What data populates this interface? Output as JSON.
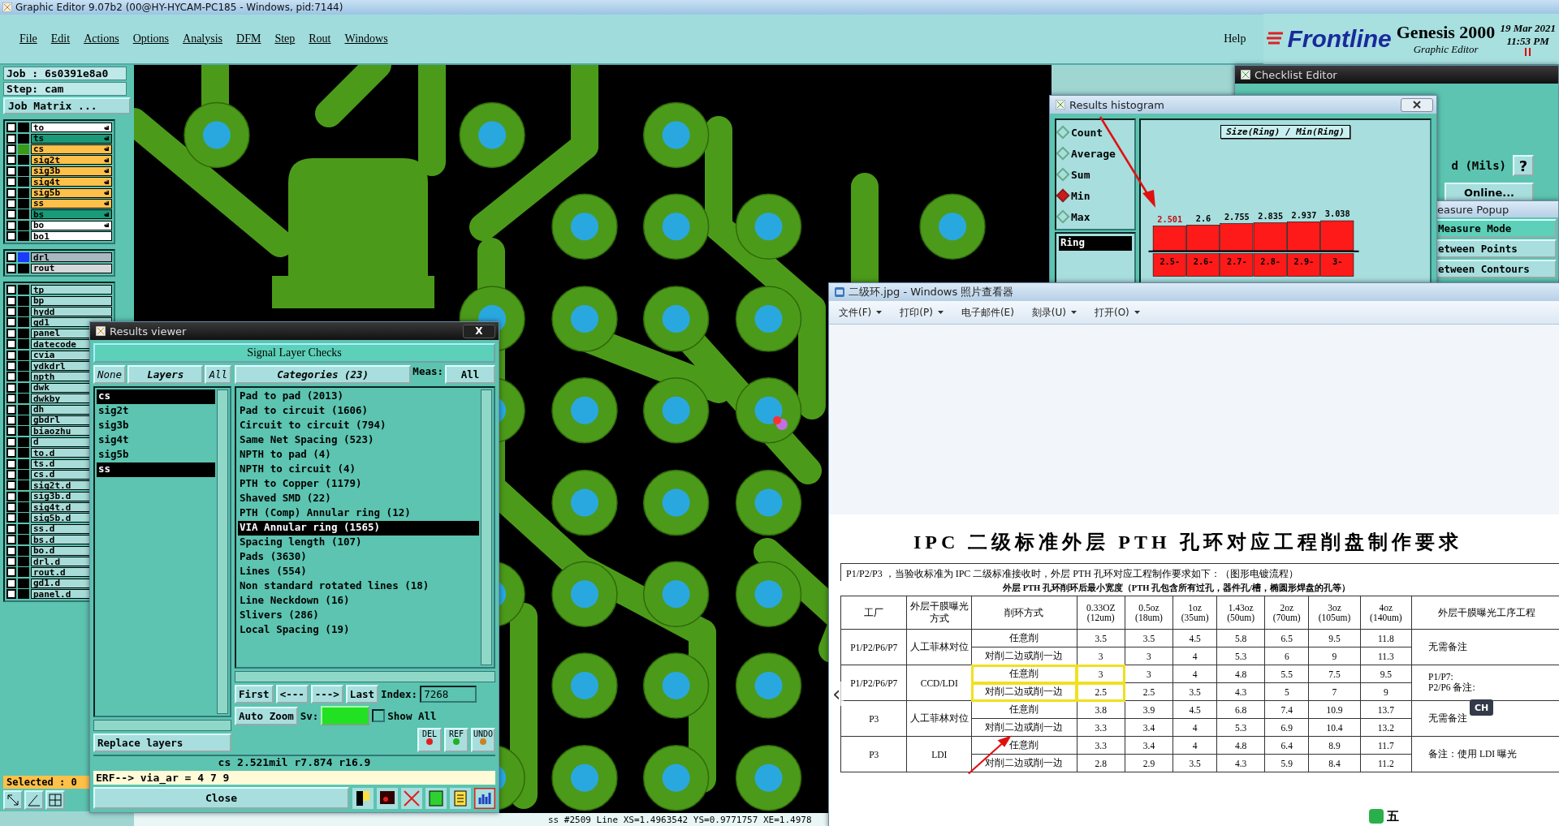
{
  "window": {
    "title": "Graphic Editor 9.07b2 (00@HY-HYCAM-PC185 - Windows, pid:7144)"
  },
  "menu": [
    "File",
    "Edit",
    "Actions",
    "Options",
    "Analysis",
    "DFM",
    "Step",
    "Rout",
    "Windows"
  ],
  "help": "Help",
  "brand": {
    "logo": "Frontline",
    "product": "Genesis 2000",
    "subtitle": "Graphic Editor",
    "date": "19 Mar 2021",
    "time": "11:53 PM"
  },
  "job": {
    "job": "Job : 6s0391e8a0",
    "step": "Step: cam",
    "matrix_button": "Job Matrix ..."
  },
  "layer_groups": [
    [
      {
        "name": "to",
        "checked": false,
        "color": "#ffffff",
        "hand_icon": true
      },
      {
        "name": "ts",
        "checked": false,
        "color": "#1a9a78",
        "hand_icon": true
      },
      {
        "name": "cs",
        "checked": false,
        "color": "#ffc04a",
        "hand_icon": true,
        "marker": {
          "color": "#3a9a1a"
        }
      },
      {
        "name": "sig2t",
        "checked": false,
        "color": "#ffc04a",
        "hand_icon": true
      },
      {
        "name": "sig3b",
        "checked": false,
        "color": "#ffc04a",
        "hand_icon": true
      },
      {
        "name": "sig4t",
        "checked": false,
        "color": "#ffc04a",
        "hand_icon": true
      },
      {
        "name": "sig5b",
        "checked": false,
        "color": "#ffc04a",
        "hand_icon": true
      },
      {
        "name": "ss",
        "checked": false,
        "color": "#ffc04a",
        "hand_icon": true
      },
      {
        "name": "bs",
        "checked": false,
        "color": "#1a9a78",
        "hand_icon": true
      },
      {
        "name": "bo",
        "checked": false,
        "color": "#ffffff",
        "hand_icon": true
      },
      {
        "name": "bo1",
        "checked": false,
        "color": "#ffffff",
        "hand_icon": false
      }
    ],
    [
      {
        "name": "drl",
        "checked": false,
        "color": "#a8b8c0",
        "hand_icon": false,
        "marker": {
          "color": "#1a3aff"
        }
      },
      {
        "name": "rout",
        "checked": false,
        "color": "#d4d8d8",
        "hand_icon": false
      }
    ],
    [
      {
        "name": "tp",
        "checked": false,
        "color": "#a8dcd8",
        "hand_icon": false
      },
      {
        "name": "bp",
        "checked": false,
        "color": "#a8dcd8",
        "hand_icon": false
      },
      {
        "name": "hydd",
        "checked": false,
        "color": "#a8dcd8",
        "hand_icon": false
      },
      {
        "name": "gd1",
        "checked": false,
        "color": "#a8dcd8",
        "hand_icon": false
      },
      {
        "name": "panel",
        "checked": false,
        "color": "#a8dcd8",
        "hand_icon": false
      },
      {
        "name": "datecode",
        "checked": false,
        "color": "#a8dcd8",
        "hand_icon": false
      },
      {
        "name": "cvia",
        "checked": false,
        "color": "#a8dcd8",
        "hand_icon": false
      },
      {
        "name": "ydkdrl",
        "checked": false,
        "color": "#a8dcd8",
        "hand_icon": false
      },
      {
        "name": "npth",
        "checked": false,
        "color": "#a8dcd8",
        "hand_icon": false
      },
      {
        "name": "dwk",
        "checked": false,
        "color": "#a8dcd8",
        "hand_icon": false
      },
      {
        "name": "dwkby",
        "checked": false,
        "color": "#a8dcd8",
        "hand_icon": false
      },
      {
        "name": "dh",
        "checked": false,
        "color": "#a8dcd8",
        "hand_icon": false
      },
      {
        "name": "gbdrl",
        "checked": false,
        "color": "#a8dcd8",
        "hand_icon": false
      },
      {
        "name": "biaozhu",
        "checked": false,
        "color": "#a8dcd8",
        "hand_icon": false
      },
      {
        "name": "d",
        "checked": false,
        "color": "#a8dcd8",
        "hand_icon": false
      },
      {
        "name": "to.d",
        "checked": false,
        "color": "#a8dcd8",
        "hand_icon": false
      },
      {
        "name": "ts.d",
        "checked": false,
        "color": "#a8dcd8",
        "hand_icon": false
      },
      {
        "name": "cs.d",
        "checked": false,
        "color": "#a8dcd8",
        "hand_icon": false
      },
      {
        "name": "sig2t.d",
        "checked": false,
        "color": "#a8dcd8",
        "hand_icon": false
      },
      {
        "name": "sig3b.d",
        "checked": false,
        "color": "#a8dcd8",
        "hand_icon": false
      },
      {
        "name": "sig4t.d",
        "checked": false,
        "color": "#a8dcd8",
        "hand_icon": false
      },
      {
        "name": "sig5b.d",
        "checked": false,
        "color": "#a8dcd8",
        "hand_icon": false
      },
      {
        "name": "ss.d",
        "checked": false,
        "color": "#a8dcd8",
        "hand_icon": false
      },
      {
        "name": "bs.d",
        "checked": false,
        "color": "#a8dcd8",
        "hand_icon": false
      },
      {
        "name": "bo.d",
        "checked": false,
        "color": "#a8dcd8",
        "hand_icon": false
      },
      {
        "name": "drl.d",
        "checked": false,
        "color": "#a8dcd8",
        "hand_icon": false
      },
      {
        "name": "rout.d",
        "checked": false,
        "color": "#a8dcd8",
        "hand_icon": false
      },
      {
        "name": "gd1.d",
        "checked": false,
        "color": "#a8dcd8",
        "hand_icon": false
      },
      {
        "name": "panel.d",
        "checked": false,
        "color": "#a8dcd8",
        "hand_icon": false
      }
    ]
  ],
  "selected_count": "Selected : 0",
  "status_line": "ss #2509 Line XS=1.4963542 YS=0.9771757 XE=1.4978",
  "results_viewer": {
    "title": "Results viewer",
    "close_glyph": "X",
    "heading": "Signal Layer Checks",
    "layer_buttons": [
      "None",
      "Layers",
      "All"
    ],
    "layers": [
      {
        "name": "cs",
        "selected": true
      },
      {
        "name": "sig2t",
        "selected": false
      },
      {
        "name": "sig3b",
        "selected": false
      },
      {
        "name": "sig4t",
        "selected": false
      },
      {
        "name": "sig5b",
        "selected": false
      },
      {
        "name": "ss",
        "selected": true
      }
    ],
    "categories_title": "Categories (23)",
    "meas_label": "Meas:",
    "meas_value": "All",
    "categories": [
      {
        "label": "Pad to pad (2013)",
        "selected": false
      },
      {
        "label": "Pad to circuit (1606)",
        "selected": false
      },
      {
        "label": "Circuit to circuit (794)",
        "selected": false
      },
      {
        "label": "Same Net Spacing (523)",
        "selected": false
      },
      {
        "label": "NPTH to pad (4)",
        "selected": false
      },
      {
        "label": "NPTH to circuit (4)",
        "selected": false
      },
      {
        "label": "PTH to Copper (1179)",
        "selected": false
      },
      {
        "label": "Shaved SMD (22)",
        "selected": false
      },
      {
        "label": "PTH (Comp) Annular ring (12)",
        "selected": false
      },
      {
        "label": "VIA Annular ring (1565)",
        "selected": true
      },
      {
        "label": "Spacing length (107)",
        "selected": false
      },
      {
        "label": "Pads (3630)",
        "selected": false
      },
      {
        "label": "Lines (554)",
        "selected": false
      },
      {
        "label": "Non standard rotated lines (18)",
        "selected": false
      },
      {
        "label": "Line Neckdown (16)",
        "selected": false
      },
      {
        "label": "Slivers (286)",
        "selected": false
      },
      {
        "label": "Local Spacing (19)",
        "selected": false
      }
    ],
    "nav_buttons": [
      "First",
      "<---",
      "--->",
      "Last"
    ],
    "index_label": "Index:",
    "index_value": "7268",
    "zoom_mode": "Auto Zoom",
    "sv_label": "Sv:",
    "sv": {
      "color": "#22e022"
    },
    "show_all": {
      "label": "Show All",
      "checked": false
    },
    "replace_mode": "Replace layers",
    "action_buttons": [
      "DEL",
      "REF",
      "UNDO"
    ],
    "measurement": "cs 2.521mil   r7.874   r16.9",
    "erf": "ERF--> via_ar = 4 7 9",
    "close": "Close"
  },
  "checklist_editor": {
    "title": "Checklist Editor",
    "units": "d (Mils)",
    "help": "?",
    "online": "Online..."
  },
  "measure_popup": {
    "title": "easure Popup",
    "items": [
      {
        "label": "Measure Mode",
        "selected": true
      },
      {
        "label": "etween Points",
        "selected": false
      },
      {
        "label": "etween Contours",
        "selected": false
      }
    ]
  },
  "histogram": {
    "title": "Results histogram",
    "modes": [
      {
        "label": "Count",
        "selected": false
      },
      {
        "label": "Average",
        "selected": false
      },
      {
        "label": "Sum",
        "selected": false
      },
      {
        "label": "Min",
        "selected": true
      },
      {
        "label": "Max",
        "selected": false
      }
    ],
    "fields": [
      {
        "label": "Ring",
        "selected": true
      }
    ],
    "chart_data": {
      "type": "bar",
      "title": "Size(Ring) / Min(Ring)",
      "categories": [
        "2.5-",
        "2.6-",
        "2.7-",
        "2.8-",
        "2.9-",
        "3-"
      ],
      "values": [
        2.501,
        2.6,
        2.755,
        2.835,
        2.937,
        3.038
      ],
      "data_labels": true
    }
  },
  "photo_viewer": {
    "title": "二级环.jpg - Windows 照片查看器",
    "menu": [
      {
        "label": "文件(F)",
        "dropdown": true
      },
      {
        "label": "打印(P)",
        "dropdown": true
      },
      {
        "label": "电子邮件(E)",
        "dropdown": false
      },
      {
        "label": "刻录(U)",
        "dropdown": true
      },
      {
        "label": "打开(O)",
        "dropdown": true
      }
    ],
    "document": {
      "title": "IPC 二级标准外层 PTH 孔环对应工程削盘制作要求",
      "intro": "P1/P2/P3 ，当验收标准为 IPC 二级标准接收时，外层 PTH 孔环对应工程制作要求如下：（图形电镀流程）",
      "caption": "外层 PTH 孔环削环后最小宽度（PTH 孔包含所有过孔，器件孔/槽，椭圆形焊盘的孔等）",
      "columns": [
        "工厂",
        "外层干膜曝光方式",
        "削环方式",
        "0.33OZ (12um)",
        "0.5oz (18um)",
        "1oz (35um)",
        "1.43oz (50um)",
        "2oz (70um)",
        "3oz (105um)",
        "4oz (140um)",
        "外层干膜曝光工序工程"
      ],
      "groups": [
        {
          "factory": "P1/P2/P6/P7",
          "exposure": "人工菲林对位",
          "note": [
            "无需备注"
          ],
          "highlighted": false,
          "rows": [
            {
              "method": "任意削",
              "values": [
                "3.5",
                "3.5",
                "4.5",
                "5.8",
                "6.5",
                "9.5",
                "11.8"
              ]
            },
            {
              "method": "对削二边或削一边",
              "values": [
                "3",
                "3",
                "4",
                "5.3",
                "6",
                "9",
                "11.3"
              ]
            }
          ]
        },
        {
          "factory": "P1/P2/P6/P7",
          "exposure": "CCD/LDI",
          "note": [
            "P1/P7:",
            "P2/P6 备注:"
          ],
          "highlighted": true,
          "rows": [
            {
              "method": "任意削",
              "values": [
                "3",
                "3",
                "4",
                "4.8",
                "5.5",
                "7.5",
                "9.5"
              ]
            },
            {
              "method": "对削二边或削一边",
              "values": [
                "2.5",
                "2.5",
                "3.5",
                "4.3",
                "5",
                "7",
                "9"
              ]
            }
          ]
        },
        {
          "factory": "P3",
          "exposure": "人工菲林对位",
          "note": [
            "无需备注"
          ],
          "highlighted": false,
          "rows": [
            {
              "method": "任意削",
              "values": [
                "3.8",
                "3.9",
                "4.5",
                "6.8",
                "7.4",
                "10.9",
                "13.7"
              ]
            },
            {
              "method": "对削二边或削一边",
              "values": [
                "3.3",
                "3.4",
                "4",
                "5.3",
                "6.9",
                "10.4",
                "13.2"
              ]
            }
          ]
        },
        {
          "factory": "P3",
          "exposure": "LDI",
          "note": [
            "备注：使用 LDI 曝光"
          ],
          "highlighted": false,
          "rows": [
            {
              "method": "任意削",
              "values": [
                "3.3",
                "3.4",
                "4",
                "4.8",
                "6.4",
                "8.9",
                "11.7"
              ]
            },
            {
              "method": "对削二边或削一边",
              "values": [
                "2.8",
                "2.9",
                "3.5",
                "4.3",
                "5.9",
                "8.4",
                "11.2"
              ]
            }
          ]
        }
      ]
    },
    "prev_glyph": "‹",
    "ime": {
      "lang": "CH",
      "mode": "五"
    }
  }
}
